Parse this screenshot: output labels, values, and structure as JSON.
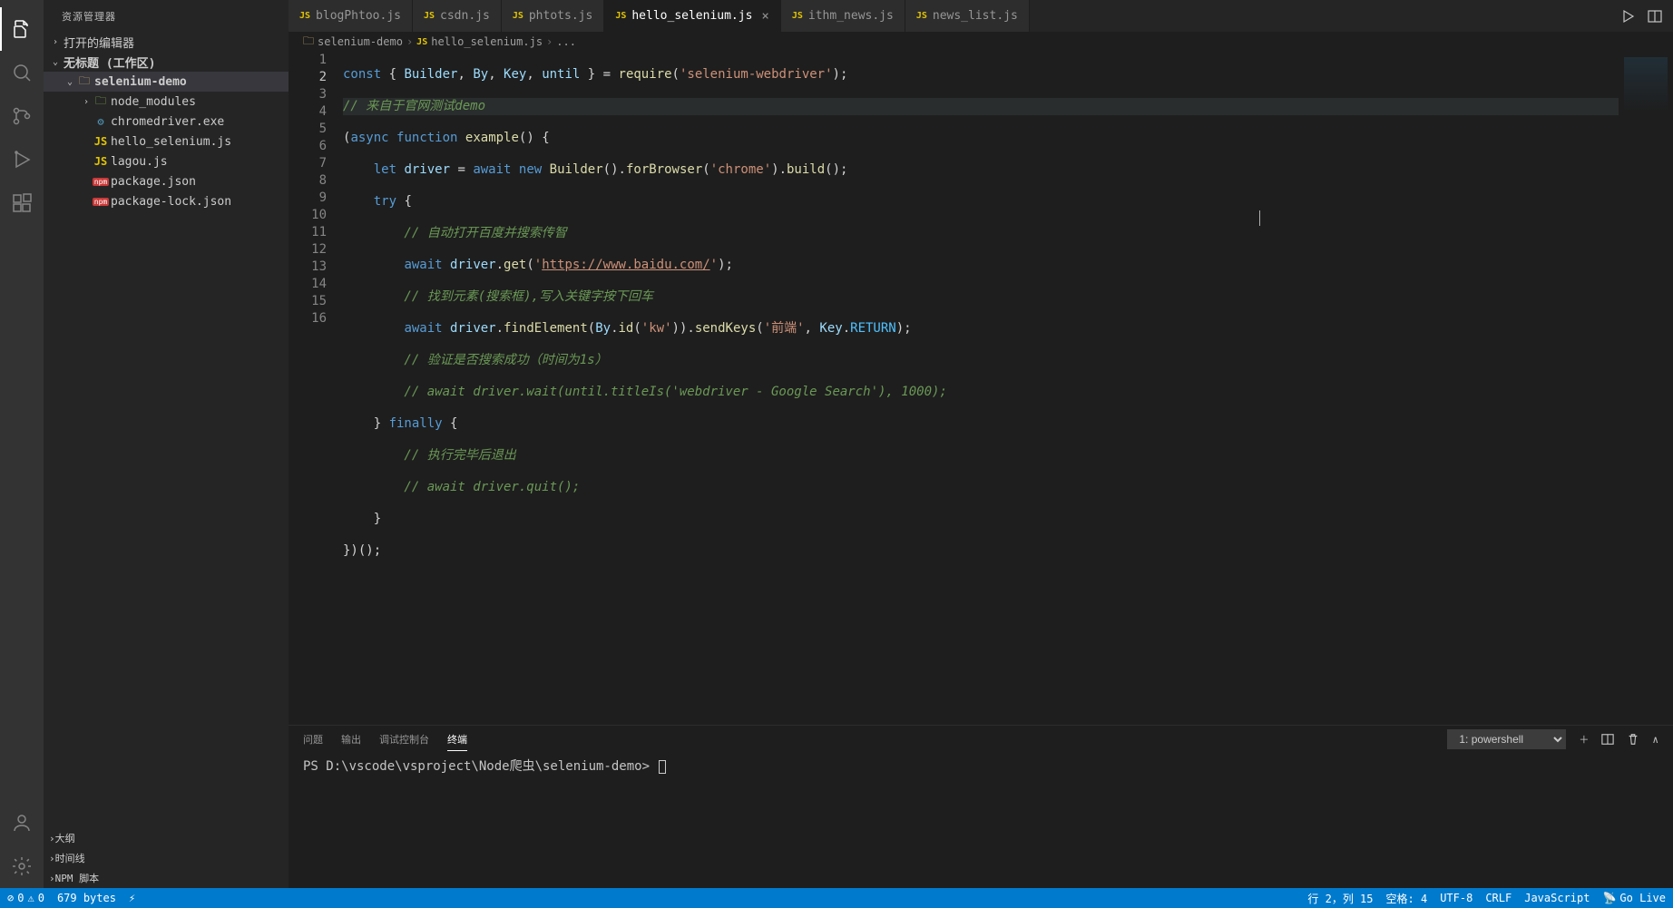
{
  "sidebar": {
    "title": "资源管理器",
    "open_editors": "打开的编辑器",
    "workspace": "无标题 (工作区)",
    "folder": "selenium-demo",
    "files": {
      "node_modules": "node_modules",
      "chromedriver": "chromedriver.exe",
      "hello_selenium": "hello_selenium.js",
      "lagou": "lagou.js",
      "package_json": "package.json",
      "package_lock": "package-lock.json"
    },
    "sections": {
      "outline": "大纲",
      "timeline": "时间线",
      "npm": "NPM 脚本"
    }
  },
  "tabs": {
    "blogPhtoo": "blogPhtoo.js",
    "csdn": "csdn.js",
    "phtots": "phtots.js",
    "hello_selenium": "hello_selenium.js",
    "ithm_news": "ithm_news.js",
    "news_list": "news_list.js"
  },
  "breadcrumbs": {
    "folder": "selenium-demo",
    "file": "hello_selenium.js",
    "rest": "..."
  },
  "code": {
    "l1a": "const",
    "l1b": " { ",
    "l1c": "Builder",
    "l1d": ", ",
    "l1e": "By",
    "l1f": ", ",
    "l1g": "Key",
    "l1h": ", ",
    "l1i": "until",
    "l1j": " } = ",
    "l1k": "require",
    "l1l": "(",
    "l1m": "'selenium-webdriver'",
    "l1n": ");",
    "l2": "// 来自于官网测试demo",
    "l3a": "(",
    "l3b": "async",
    "l3c": " ",
    "l3d": "function",
    "l3e": " ",
    "l3f": "example",
    "l3g": "() {",
    "l4a": "    ",
    "l4b": "let",
    "l4c": " ",
    "l4d": "driver",
    "l4e": " = ",
    "l4f": "await",
    "l4g": " ",
    "l4h": "new",
    "l4i": " ",
    "l4j": "Builder",
    "l4k": "().",
    "l4l": "forBrowser",
    "l4m": "(",
    "l4n": "'chrome'",
    "l4o": ").",
    "l4p": "build",
    "l4q": "();",
    "l5a": "    ",
    "l5b": "try",
    "l5c": " {",
    "l6": "        // 自动打开百度并搜索传智",
    "l7a": "        ",
    "l7b": "await",
    "l7c": " ",
    "l7d": "driver",
    "l7e": ".",
    "l7f": "get",
    "l7g": "(",
    "l7h": "'",
    "l7i": "https://www.baidu.com/",
    "l7j": "'",
    "l7k": ");",
    "l8": "        // 找到元素(搜索框),写入关键字按下回车",
    "l9a": "        ",
    "l9b": "await",
    "l9c": " ",
    "l9d": "driver",
    "l9e": ".",
    "l9f": "findElement",
    "l9g": "(",
    "l9h": "By",
    "l9i": ".",
    "l9j": "id",
    "l9k": "(",
    "l9l": "'kw'",
    "l9m": ")).",
    "l9n": "sendKeys",
    "l9o": "(",
    "l9p": "'前端'",
    "l9q": ", ",
    "l9r": "Key",
    "l9s": ".",
    "l9t": "RETURN",
    "l9u": ");",
    "l10": "        // 验证是否搜索成功（时间为1s）",
    "l11": "        // await driver.wait(until.titleIs('webdriver - Google Search'), 1000);",
    "l12a": "    } ",
    "l12b": "finally",
    "l12c": " {",
    "l13": "        // 执行完毕后退出",
    "l14": "        // await driver.quit();",
    "l15": "    }",
    "l16": "})();"
  },
  "lines": {
    "1": "1",
    "2": "2",
    "3": "3",
    "4": "4",
    "5": "5",
    "6": "6",
    "7": "7",
    "8": "8",
    "9": "9",
    "10": "10",
    "11": "11",
    "12": "12",
    "13": "13",
    "14": "14",
    "15": "15",
    "16": "16"
  },
  "panel": {
    "problems": "问题",
    "output": "输出",
    "debug": "调试控制台",
    "terminal": "终端",
    "shell": "1: powershell",
    "prompt": "PS D:\\vscode\\vsproject\\Node爬虫\\selenium-demo>"
  },
  "status": {
    "errors": "0",
    "warnings": "0",
    "bytes": "679 bytes",
    "lncol": "行 2，列 15",
    "spaces": "空格: 4",
    "encoding": "UTF-8",
    "eol": "CRLF",
    "lang": "JavaScript",
    "golive": "Go Live"
  }
}
